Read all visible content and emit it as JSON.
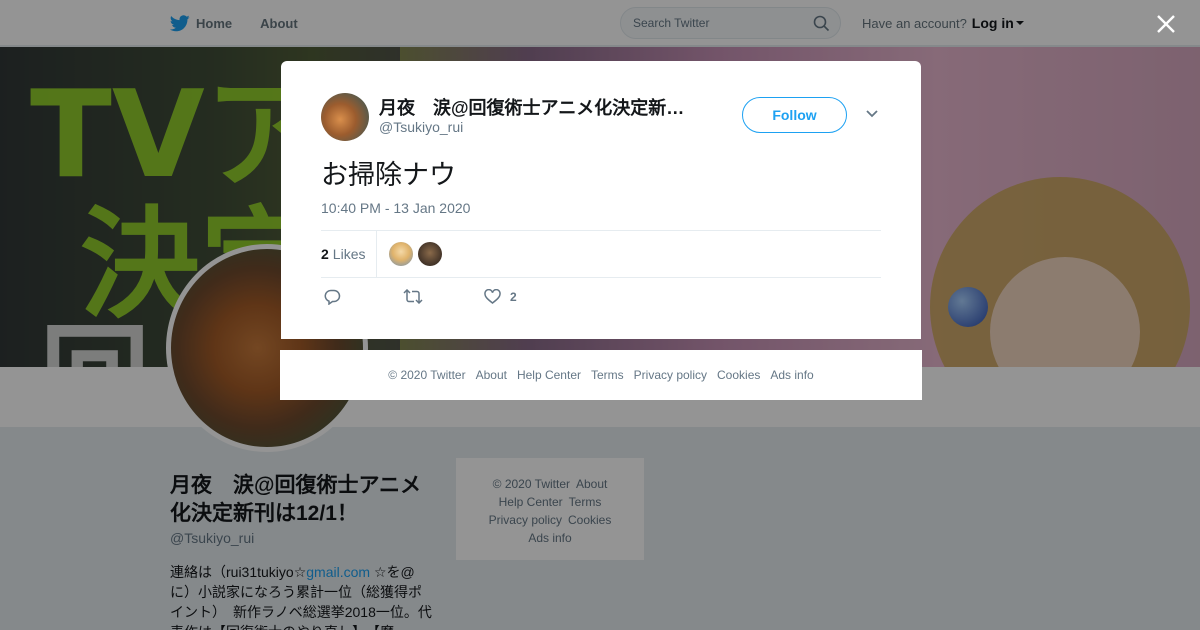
{
  "topbar": {
    "home_label": "Home",
    "about_label": "About",
    "search_placeholder": "Search Twitter",
    "account_prompt": "Have an account?",
    "login_label": "Log in"
  },
  "banner": {
    "text_line1": "TVア",
    "text_line2": "決定",
    "text_line3": "回"
  },
  "profile": {
    "name": "月夜　涙@回復術士アニメ化決定新刊は12/1！",
    "handle": "@Tsukiyo_rui",
    "bio_prefix": "連絡は（rui31tukiyo☆",
    "bio_link": "gmail.com",
    "bio_rest": " ☆を@に）小説家になろう累計一位（総獲得ポイント）　新作ラノベ総選挙2018一位。代表作は【回復術士のやり直し】、【魔"
  },
  "side_footer": {
    "copyright": "© 2020 Twitter",
    "about": "About",
    "help": "Help Center",
    "terms": "Terms",
    "privacy": "Privacy policy",
    "cookies": "Cookies",
    "ads": "Ads info"
  },
  "tweet": {
    "author_name": "月夜　涙@回復術士アニメ化決定新…",
    "author_handle": "@Tsukiyo_rui",
    "follow_label": "Follow",
    "text": "お掃除ナウ",
    "timestamp": "10:40 PM - 13 Jan 2020",
    "likes_count": "2",
    "likes_label": "Likes",
    "like_action_count": "2"
  },
  "modal_footer": {
    "copyright": "© 2020 Twitter",
    "about": "About",
    "help": "Help Center",
    "terms": "Terms",
    "privacy": "Privacy policy",
    "cookies": "Cookies",
    "ads": "Ads info"
  },
  "colors": {
    "twitter_blue": "#1da1f2",
    "text_primary": "#14171a",
    "text_secondary": "#657786"
  },
  "icons": [
    "twitter-bird-icon",
    "search-icon",
    "close-icon",
    "chevron-down-icon",
    "reply-icon",
    "retweet-icon",
    "heart-icon"
  ]
}
